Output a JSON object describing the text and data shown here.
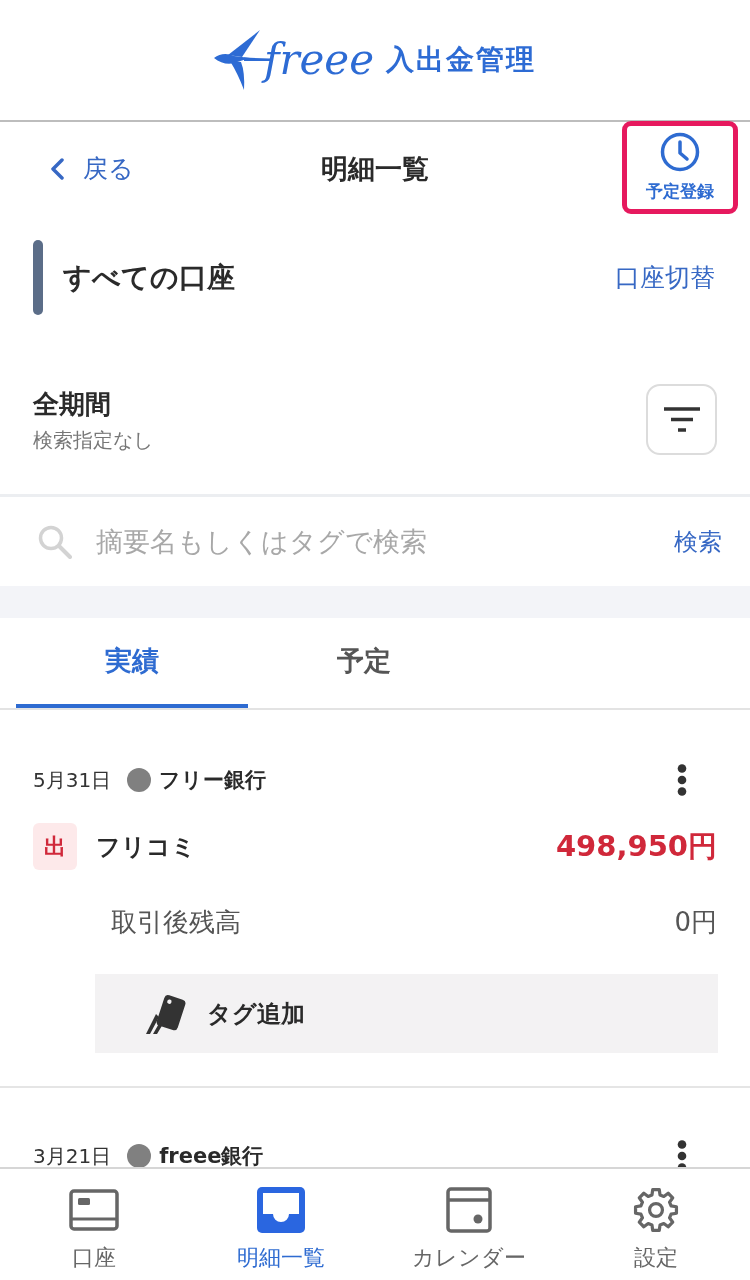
{
  "header": {
    "logo_text": "freee",
    "app_name": "入出金管理"
  },
  "nav": {
    "back": "戻る",
    "title": "明細一覧",
    "action": {
      "label": "予定登録",
      "highlighted": true
    }
  },
  "account": {
    "name": "すべての口座",
    "switch": "口座切替"
  },
  "period": {
    "title": "全期間",
    "subtitle": "検索指定なし"
  },
  "search": {
    "placeholder": "摘要名もしくはタグで検索",
    "button": "検索"
  },
  "tabs": [
    {
      "label": "実績",
      "selected": true
    },
    {
      "label": "予定",
      "selected": false
    }
  ],
  "transactions": [
    {
      "date": "5月31日",
      "bank": "フリー銀行",
      "color": "#808080",
      "kind": "out",
      "type_label": "出",
      "description": "フリコミ",
      "amount": "498,950円",
      "balance_label": "取引後残高",
      "balance": "0円",
      "tag_button": "タグ追加"
    },
    {
      "date": "3月21日",
      "bank": "freee銀行",
      "color": "#808080"
    }
  ],
  "bottom_nav": [
    {
      "label": "口座",
      "kind": "card",
      "selected": false
    },
    {
      "label": "明細一覧",
      "kind": "inbox",
      "selected": true
    },
    {
      "label": "カレンダー",
      "kind": "calendar",
      "selected": false
    },
    {
      "label": "設定",
      "kind": "gear",
      "selected": false
    }
  ]
}
